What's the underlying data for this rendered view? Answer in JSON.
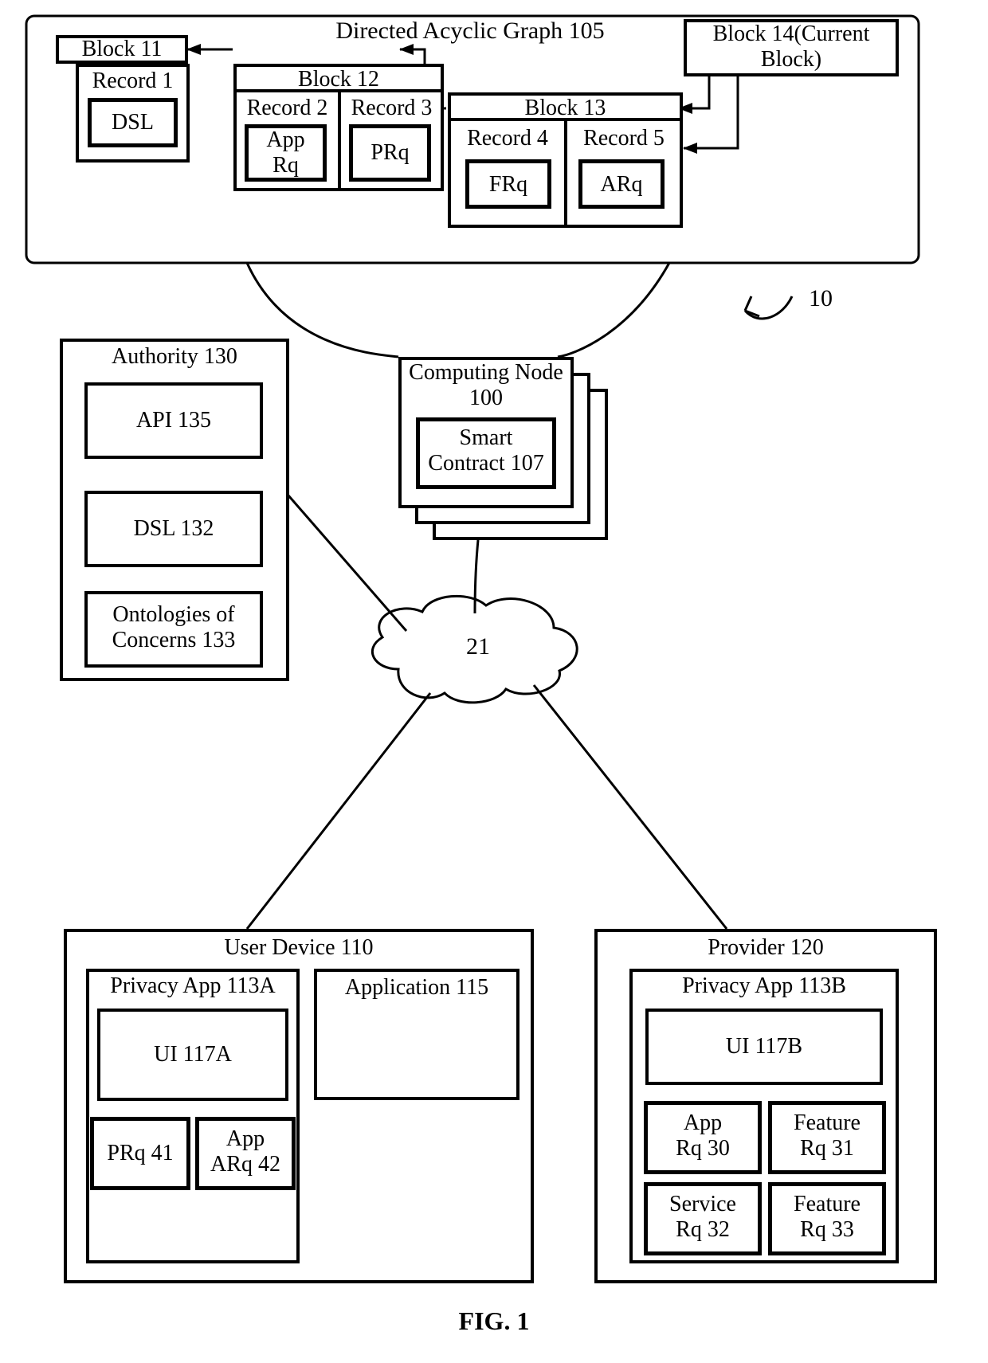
{
  "figCaption": "FIG. 1",
  "sysRef": "10",
  "dag": {
    "title": "Directed Acyclic Graph 105",
    "b11": {
      "title": "Block 11",
      "rec1": "Record 1",
      "dsl": "DSL"
    },
    "b12": {
      "title": "Block 12",
      "rec2": "Record 2",
      "rec3": "Record 3",
      "appRq": "App\nRq",
      "prq": "PRq"
    },
    "b13": {
      "title": "Block 13",
      "rec4": "Record 4",
      "rec5": "Record 5",
      "frq": "FRq",
      "arq": "ARq"
    },
    "b14": {
      "title": "Block 14(Current\nBlock)"
    }
  },
  "node": {
    "title": "Computing Node\n100",
    "sc": "Smart\nContract 107"
  },
  "authority": {
    "title": "Authority 130",
    "api": "API 135",
    "dsl": "DSL 132",
    "ont": "Ontologies of\nConcerns 133"
  },
  "cloud": {
    "label": "21"
  },
  "userDevice": {
    "title": "User Device 110",
    "privacyApp": "Privacy App 113A",
    "ui": "UI 117A",
    "prq": "PRq 41",
    "apparq": "App\nARq 42",
    "application": "Application 115"
  },
  "provider": {
    "title": "Provider 120",
    "privacyApp": "Privacy App 113B",
    "ui": "UI 117B",
    "appRq": "App\nRq 30",
    "featRq31": "Feature\nRq 31",
    "svcRq": "Service\nRq 32",
    "featRq33": "Feature\nRq 33"
  }
}
